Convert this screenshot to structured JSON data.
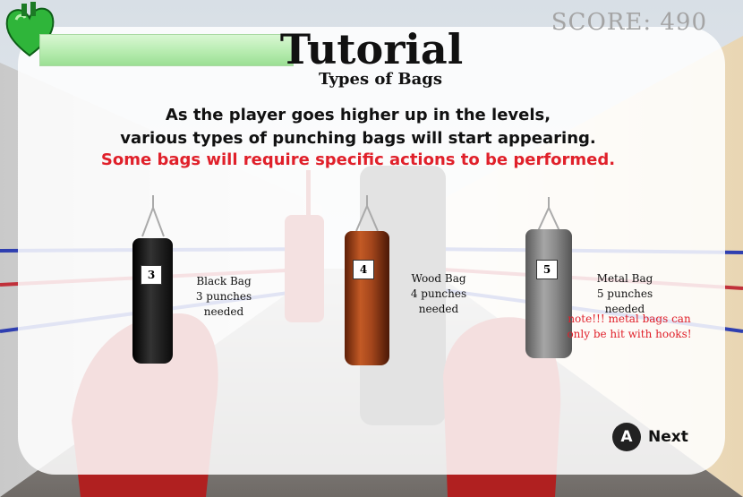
{
  "hud": {
    "score_label": "SCORE:",
    "score_value": "490",
    "health_fraction": 0.62,
    "heart_icon": "heart-icon",
    "health_color": "#b7ecb0"
  },
  "tutorial": {
    "title": "Tutorial",
    "subtitle": "Types of Bags",
    "line1": "As the player goes higher up in the levels,",
    "line2": "various types of punching bags will start appearing.",
    "line3": "Some bags will require specific actions to be performed.",
    "warning_color": "#e0202a"
  },
  "bags": [
    {
      "number": "3",
      "name": "Black Bag",
      "requirement": "3 punches needed",
      "color": "#1a1a1a"
    },
    {
      "number": "4",
      "name": "Wood Bag",
      "requirement": "4 punches needed",
      "color": "#a4461c"
    },
    {
      "number": "5",
      "name": "Metal Bag",
      "requirement": "5 punches needed",
      "color": "#8a8a8a",
      "note_line1": "note!!! metal bags can",
      "note_line2": "only be hit with hooks!"
    }
  ],
  "controls": {
    "button_glyph": "A",
    "next_label": "Next"
  }
}
